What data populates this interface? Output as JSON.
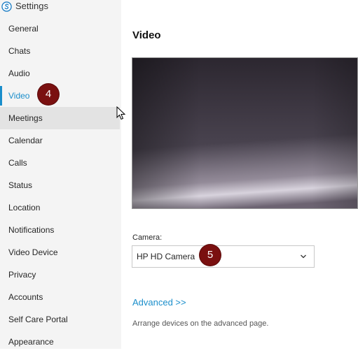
{
  "app": {
    "title": "Settings",
    "icon": "skype-logo-icon",
    "accent": "#1a8ecb"
  },
  "sidebar": {
    "items": [
      {
        "label": "General"
      },
      {
        "label": "Chats"
      },
      {
        "label": "Audio"
      },
      {
        "label": "Video",
        "selected": true
      },
      {
        "label": "Meetings",
        "hovered": true
      },
      {
        "label": "Calendar"
      },
      {
        "label": "Calls"
      },
      {
        "label": "Status"
      },
      {
        "label": "Location"
      },
      {
        "label": "Notifications"
      },
      {
        "label": "Video Device"
      },
      {
        "label": "Privacy"
      },
      {
        "label": "Accounts"
      },
      {
        "label": "Self Care Portal"
      },
      {
        "label": "Appearance"
      }
    ]
  },
  "annotations": {
    "video_step": "4",
    "camera_step": "5",
    "badge_color": "#7a1010"
  },
  "main": {
    "title": "Video",
    "camera": {
      "label": "Camera:",
      "value": "HP HD Camera"
    },
    "advanced": {
      "link": "Advanced >>",
      "note": "Arrange devices on the advanced page."
    }
  }
}
